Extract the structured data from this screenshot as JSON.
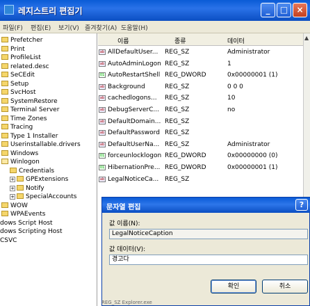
{
  "window": {
    "title": "레지스트리 편집기",
    "min": "_",
    "max": "□",
    "close": "×"
  },
  "menu": [
    "파일(F)",
    "편집(E)",
    "보기(V)",
    "즐겨찾기(A)",
    "도움말(H)"
  ],
  "tree": [
    {
      "label": "Prefetcher",
      "indent": 0
    },
    {
      "label": "Print",
      "indent": 0
    },
    {
      "label": "ProfileList",
      "indent": 0
    },
    {
      "label": "related.desc",
      "indent": 0
    },
    {
      "label": "SeCEdit",
      "indent": 0
    },
    {
      "label": "Setup",
      "indent": 0
    },
    {
      "label": "SvcHost",
      "indent": 0
    },
    {
      "label": "SystemRestore",
      "indent": 0
    },
    {
      "label": "Terminal Server",
      "indent": 0
    },
    {
      "label": "Time Zones",
      "indent": 0
    },
    {
      "label": "Tracing",
      "indent": 0
    },
    {
      "label": "Type 1 Installer",
      "indent": 0
    },
    {
      "label": "Userinstallable.drivers",
      "indent": 0
    },
    {
      "label": "Windows",
      "indent": 0
    },
    {
      "label": "Winlogon",
      "indent": 0,
      "open": true
    },
    {
      "label": "Credentials",
      "indent": 1
    },
    {
      "label": "GPExtensions",
      "indent": 1,
      "expander": "+"
    },
    {
      "label": "Notify",
      "indent": 1,
      "expander": "+"
    },
    {
      "label": "SpecialAccounts",
      "indent": 1,
      "expander": "+"
    },
    {
      "label": "WOW",
      "indent": 0
    },
    {
      "label": "WPAEvents",
      "indent": 0
    },
    {
      "label": "dows Script Host",
      "indent": -1
    },
    {
      "label": "dows Scripting Host",
      "indent": -1
    },
    {
      "label": "CSVC",
      "indent": -1
    }
  ],
  "list": {
    "columns": {
      "name": "이름",
      "type": "종류",
      "data": "데이터"
    },
    "rows": [
      {
        "name": "AllDefaultUser...",
        "type": "REG_SZ",
        "data": "Administrator",
        "bin": false
      },
      {
        "name": "AutoAdminLogon",
        "type": "REG_SZ",
        "data": "1",
        "bin": false
      },
      {
        "name": "AutoRestartShell",
        "type": "REG_DWORD",
        "data": "0x00000001 (1)",
        "bin": true
      },
      {
        "name": "Background",
        "type": "REG_SZ",
        "data": "0 0 0",
        "bin": false
      },
      {
        "name": "cachedlogons...",
        "type": "REG_SZ",
        "data": "10",
        "bin": false
      },
      {
        "name": "DebugServerC...",
        "type": "REG_SZ",
        "data": "no",
        "bin": false
      },
      {
        "name": "DefaultDomain...",
        "type": "REG_SZ",
        "data": "",
        "bin": false
      },
      {
        "name": "DefaultPassword",
        "type": "REG_SZ",
        "data": "",
        "bin": false
      },
      {
        "name": "DefaultUserNa...",
        "type": "REG_SZ",
        "data": "Administrator",
        "bin": false
      },
      {
        "name": "forceunlocklogon",
        "type": "REG_DWORD",
        "data": "0x00000000 (0)",
        "bin": true
      },
      {
        "name": "HibernationPre...",
        "type": "REG_DWORD",
        "data": "0x00000001 (1)",
        "bin": true
      },
      {
        "name": "LegalNoticeCa...",
        "type": "REG_SZ",
        "data": "",
        "bin": false
      }
    ]
  },
  "dialog": {
    "title": "문자열 편집",
    "help": "?",
    "name_label": "값 이름(N):",
    "name_value": "LegalNoticeCaption",
    "data_label": "값 데이터(V):",
    "data_value": "경고다",
    "ok": "확인",
    "cancel": "취소"
  },
  "behind_text": "REG_SZ     Explorer.exe"
}
